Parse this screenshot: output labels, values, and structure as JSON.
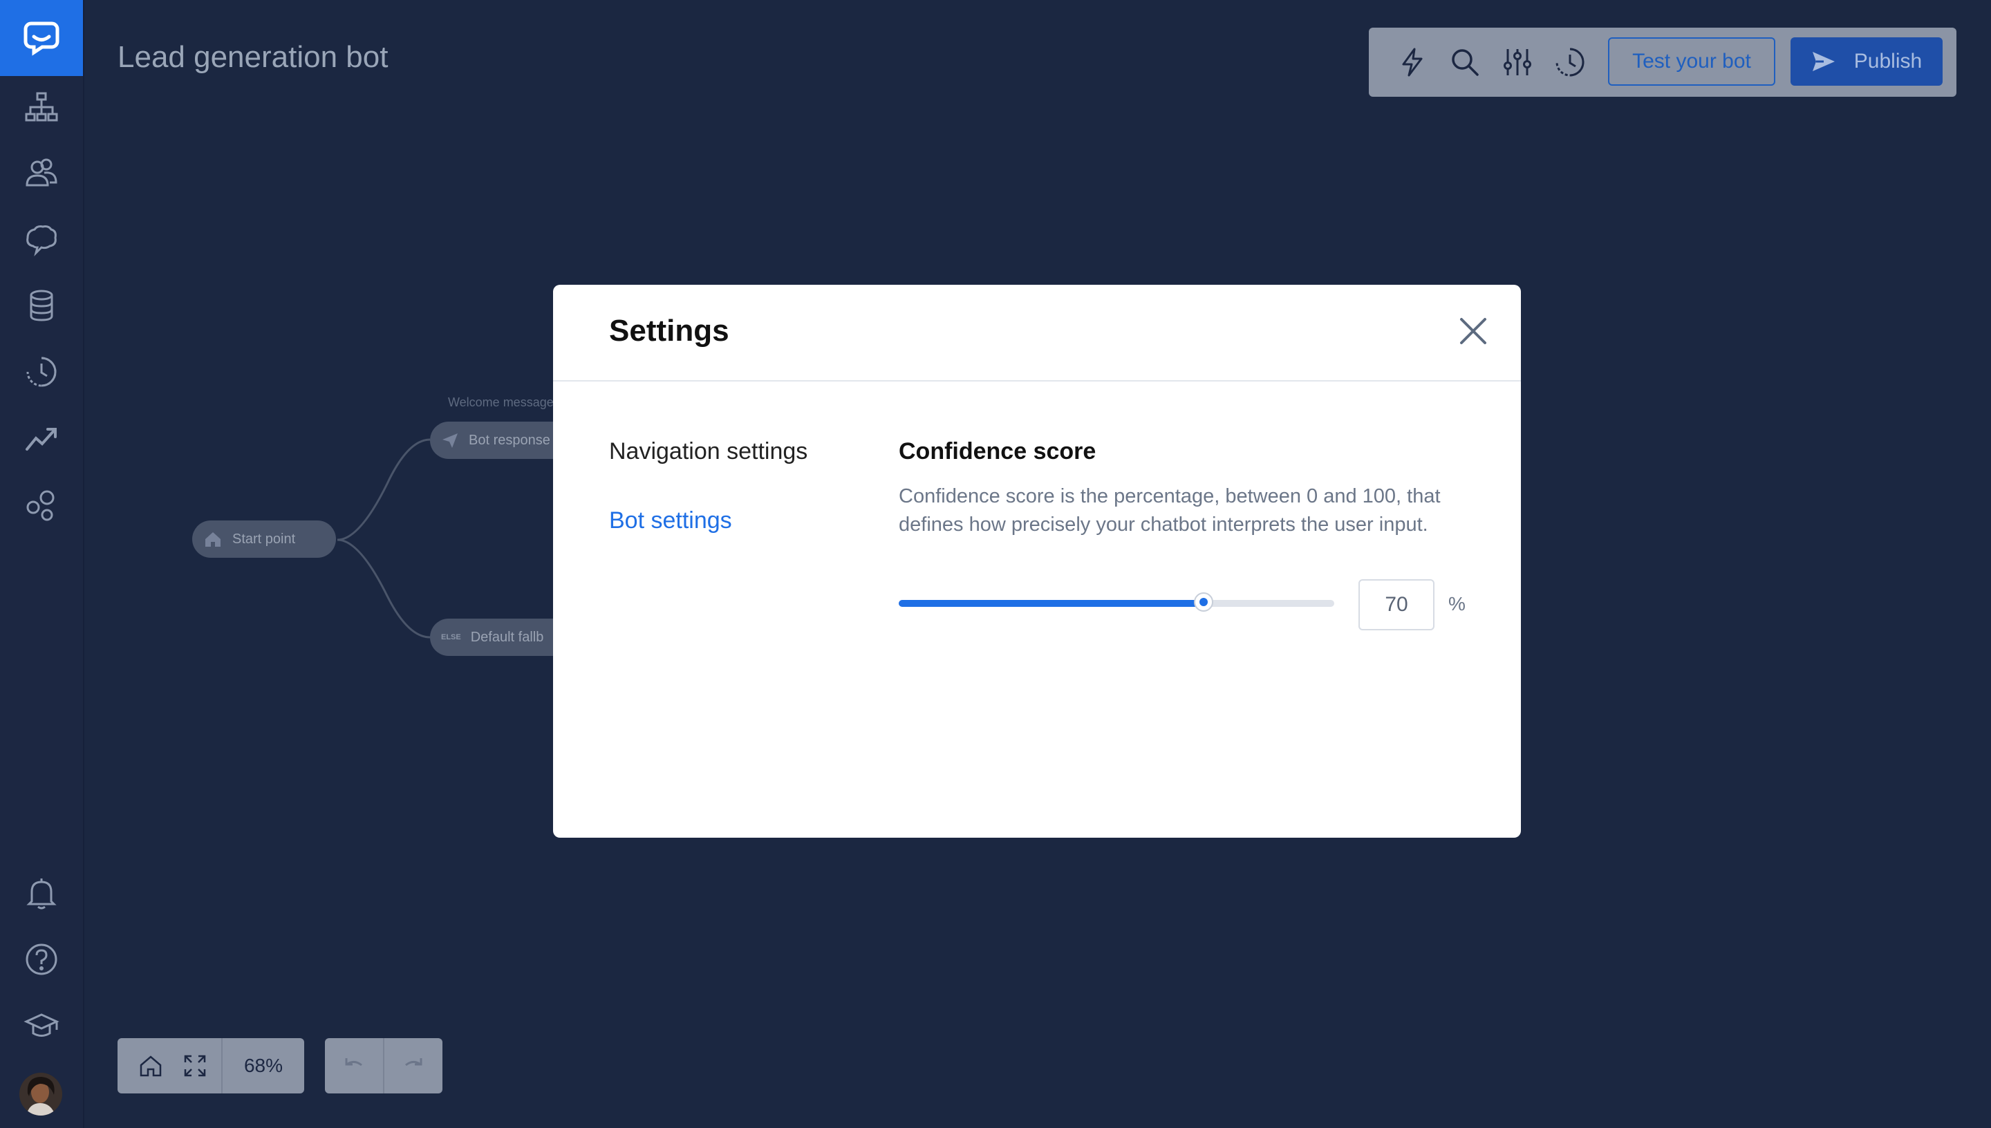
{
  "page": {
    "title": "Lead generation bot"
  },
  "toolbar": {
    "test_label": "Test your bot",
    "publish_label": "Publish"
  },
  "flow": {
    "start_label": "Start point",
    "welcome_caption": "Welcome message",
    "bot_response_label": "Bot response",
    "else_tag": "ELSE",
    "fallback_label": "Default fallb"
  },
  "zoom": {
    "level": "68%"
  },
  "modal": {
    "title": "Settings",
    "tabs": [
      {
        "label": "Navigation settings",
        "active": false
      },
      {
        "label": "Bot settings",
        "active": true
      }
    ],
    "section_title": "Confidence score",
    "section_desc": "Confidence score is the percentage, between 0 and 100, that defines how precisely your chatbot interprets the user input.",
    "confidence_value": "70",
    "confidence_fraction": 0.7,
    "unit": "%"
  },
  "colors": {
    "accent": "#1f6fe5",
    "background": "#1b2741",
    "publish": "#1f4fa8"
  },
  "icons": {
    "sidebar": [
      "chat-logo-icon",
      "flow-tree-icon",
      "users-icon",
      "brain-icon",
      "database-icon",
      "history-icon",
      "analytics-icon",
      "integrations-icon",
      "bell-icon",
      "help-icon",
      "academy-icon"
    ],
    "toolbar": [
      "lightning-icon",
      "search-icon",
      "sliders-icon",
      "history-icon"
    ]
  }
}
